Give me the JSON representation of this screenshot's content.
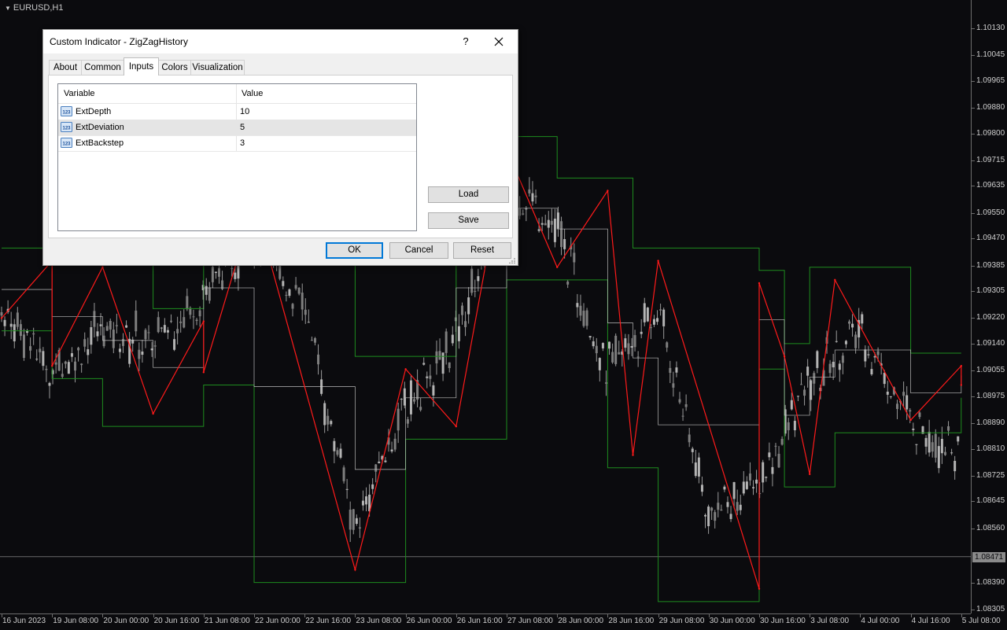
{
  "chart": {
    "symbol": "EURUSD,H1",
    "current_price": "1.08471",
    "price_labels": [
      "1.10130",
      "1.10045",
      "1.09965",
      "1.09880",
      "1.09800",
      "1.09715",
      "1.09635",
      "1.09550",
      "1.09470",
      "1.09385",
      "1.09305",
      "1.09220",
      "1.09140",
      "1.09055",
      "1.08975",
      "1.08890",
      "1.08810",
      "1.08725",
      "1.08645",
      "1.08560",
      "1.08390",
      "1.08305"
    ],
    "time_labels": [
      "16 Jun 2023",
      "19 Jun 08:00",
      "20 Jun 00:00",
      "20 Jun 16:00",
      "21 Jun 08:00",
      "22 Jun 00:00",
      "22 Jun 16:00",
      "23 Jun 08:00",
      "26 Jun 00:00",
      "26 Jun 16:00",
      "27 Jun 08:00",
      "28 Jun 00:00",
      "28 Jun 16:00",
      "29 Jun 08:00",
      "30 Jun 00:00",
      "30 Jun 16:00",
      "3 Jul 08:00",
      "4 Jul 00:00",
      "4 Jul 16:00",
      "5 Jul 08:00"
    ],
    "colors": {
      "background": "#0b0b0e",
      "candle": "#9a9a9a",
      "zigzag": "#ff1a1a",
      "channel": "#1e8c1e",
      "midline": "#c8c8c8"
    }
  },
  "chart_data": {
    "type": "line",
    "series": [
      {
        "name": "",
        "x": [
          "16 Jun 2023",
          "19 Jun 08:00",
          "20 Jun 00:00",
          "20 Jun 16:00",
          "21 Jun 08:00",
          "22 Jun 00:00",
          "22 Jun 16:00",
          "23 Jun 08:00",
          "26 Jun 00:00",
          "26 Jun 16:00",
          "27 Jun 08:00",
          "28 Jun 00:00",
          "28 Jun 16:00",
          "29 Jun 08:00",
          "30 Jun 00:00",
          "30 Jun 16:00",
          "3 Jul 08:00",
          "4 Jul 00:00",
          "4 Jul 16:00",
          "5 Jul 08:00"
        ],
        "values": [
          1.0926,
          1.0905,
          1.0918,
          1.0914,
          1.093,
          1.0948,
          1.0925,
          1.0855,
          1.0895,
          1.0915,
          1.0965,
          1.095,
          1.0905,
          1.0925,
          1.086,
          1.087,
          1.0902,
          1.0918,
          1.089,
          1.088
        ]
      }
    ],
    "zigzag_pivots": [
      {
        "x": "16 Jun 2023",
        "y": 1.0922
      },
      {
        "x": "19 Jun 08:00",
        "y": 1.094
      },
      {
        "x": "19 Jun 08:00",
        "y": 1.0907
      },
      {
        "x": "20 Jun 00:00",
        "y": 1.0938
      },
      {
        "x": "20 Jun 16:00",
        "y": 1.0892
      },
      {
        "x": "21 Jun 08:00",
        "y": 1.0921
      },
      {
        "x": "21 Jun 08:00",
        "y": 1.0905
      },
      {
        "x": "22 Jun 00:00",
        "y": 1.0958
      },
      {
        "x": "23 Jun 08:00",
        "y": 1.0843
      },
      {
        "x": "26 Jun 00:00",
        "y": 1.0906
      },
      {
        "x": "26 Jun 16:00",
        "y": 1.0888
      },
      {
        "x": "27 Jun 08:00",
        "y": 1.0975
      },
      {
        "x": "28 Jun 00:00",
        "y": 1.0938
      },
      {
        "x": "28 Jun 16:00",
        "y": 1.0962
      },
      {
        "x": "29 Jun 00:00",
        "y": 1.0879
      },
      {
        "x": "29 Jun 08:00",
        "y": 1.094
      },
      {
        "x": "30 Jun 16:00",
        "y": 1.0837
      },
      {
        "x": "30 Jun 16:00",
        "y": 1.0933
      },
      {
        "x": "3 Jul 00:00",
        "y": 1.091
      },
      {
        "x": "3 Jul 08:00",
        "y": 1.0873
      },
      {
        "x": "3 Jul 16:00",
        "y": 1.0934
      },
      {
        "x": "4 Jul 16:00",
        "y": 1.089
      },
      {
        "x": "5 Jul 08:00",
        "y": 1.0907
      },
      {
        "x": "5 Jul 08:00",
        "y": 1.0901
      }
    ],
    "title": "",
    "xlabel": "",
    "ylabel": "",
    "ylim": [
      1.08305,
      1.1013
    ],
    "grid": false
  },
  "dialog": {
    "title": "Custom Indicator - ZigZagHistory",
    "help_label": "?",
    "tabs": [
      {
        "label": "About"
      },
      {
        "label": "Common"
      },
      {
        "label": "Inputs"
      },
      {
        "label": "Colors"
      },
      {
        "label": "Visualization"
      }
    ],
    "active_tab": "Inputs",
    "grid": {
      "headers": {
        "variable": "Variable",
        "value": "Value"
      },
      "rows": [
        {
          "variable": "ExtDepth",
          "value": "10",
          "icon": "numeric-123-icon"
        },
        {
          "variable": "ExtDeviation",
          "value": "5",
          "icon": "numeric-123-icon"
        },
        {
          "variable": "ExtBackstep",
          "value": "3",
          "icon": "numeric-123-icon"
        }
      ]
    },
    "buttons": {
      "load": "Load",
      "save": "Save",
      "ok": "OK",
      "cancel": "Cancel",
      "reset": "Reset"
    }
  }
}
